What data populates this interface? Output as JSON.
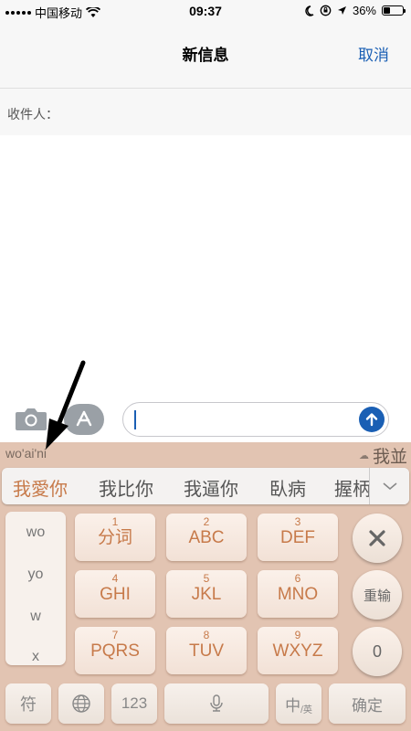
{
  "status_bar": {
    "carrier": "中国移动",
    "time": "09:37",
    "battery_percent": "36%",
    "battery_level": 0.36,
    "icons": [
      "signal-dots-icon",
      "wifi-icon",
      "moon-icon",
      "orientation-lock-icon",
      "location-arrow-icon",
      "battery-icon"
    ]
  },
  "nav": {
    "title": "新信息",
    "cancel_label": "取消"
  },
  "recipient": {
    "label": "收件人："
  },
  "composer": {
    "camera_icon": "camera-icon",
    "apps_icon": "app-store-icon",
    "send_icon": "send-arrow-icon",
    "message_value": ""
  },
  "keyboard": {
    "pinyin": "wo'ai'ni",
    "preview_text": "我並",
    "candidates": [
      "我愛你",
      "我比你",
      "我逼你",
      "臥病",
      "握柄"
    ],
    "pinyin_options": [
      "wo",
      "yo",
      "w",
      "x"
    ],
    "keys": [
      {
        "num": "1",
        "label": "分词"
      },
      {
        "num": "2",
        "label": "ABC"
      },
      {
        "num": "3",
        "label": "DEF"
      },
      {
        "num": "4",
        "label": "GHI"
      },
      {
        "num": "5",
        "label": "JKL"
      },
      {
        "num": "6",
        "label": "MNO"
      },
      {
        "num": "7",
        "label": "PQRS"
      },
      {
        "num": "8",
        "label": "TUV"
      },
      {
        "num": "9",
        "label": "WXYZ"
      }
    ],
    "delete_icon": "close-icon",
    "reenter_label": "重输",
    "zero_label": "0",
    "symbols_label": "符",
    "globe_icon": "globe-icon",
    "numbers_label": "123",
    "mic_icon": "microphone-icon",
    "lang_main": "中",
    "lang_sub": "/英",
    "confirm_label": "确定"
  },
  "colors": {
    "accent": "#1a5fb4",
    "keyboard_bg": "#e2c4b2",
    "key_text": "#c77a4a"
  }
}
